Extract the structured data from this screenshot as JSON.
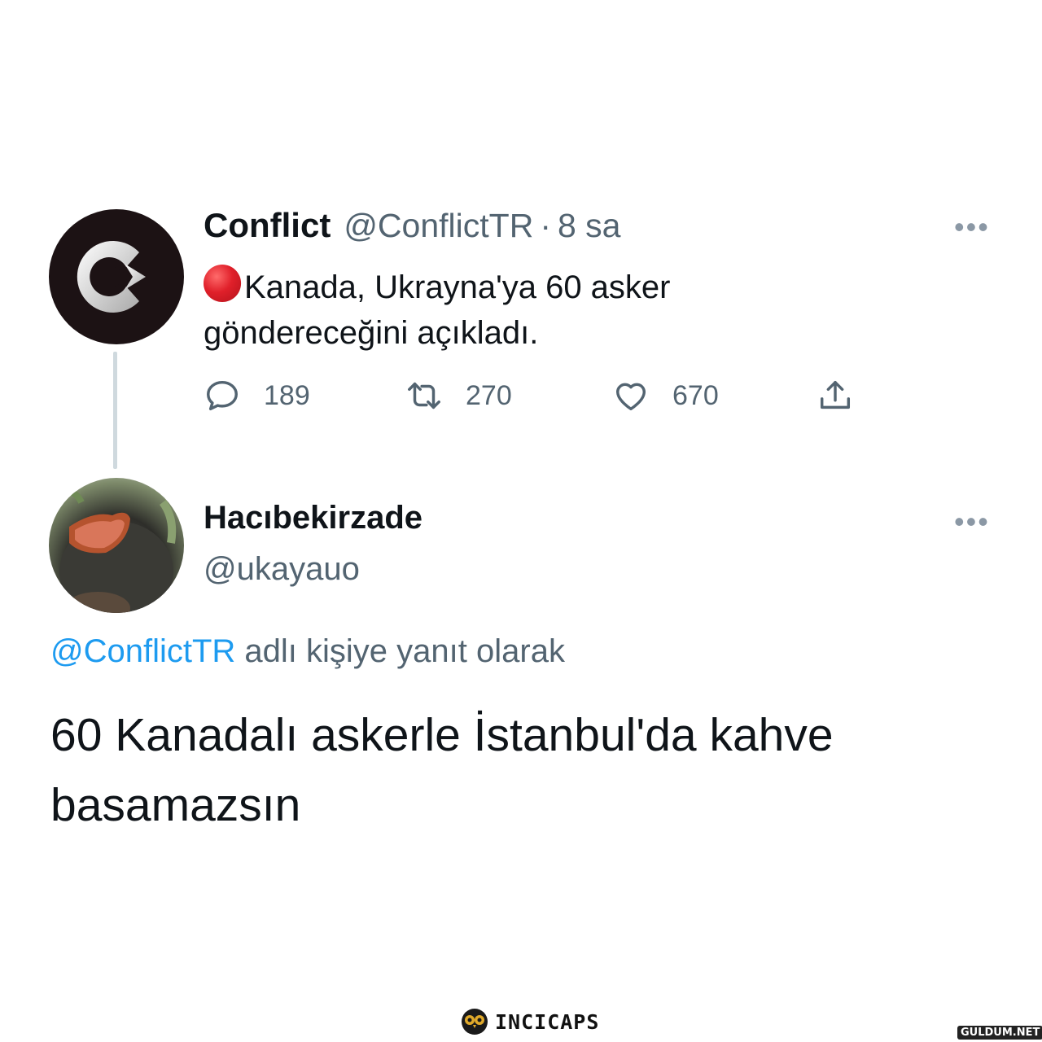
{
  "tweet": {
    "name": "Conflict",
    "handle": "@ConflictTR",
    "separator": "·",
    "time": "8 sa",
    "text_line1": "Kanada, Ukrayna'ya 60 asker",
    "text_line2": "göndereceğini açıkladı.",
    "more": "•••",
    "reply_count": "189",
    "retweet_count": "270",
    "like_count": "670"
  },
  "reply": {
    "name": "Hacıbekirzade",
    "handle": "@ukayauo",
    "more": "•••",
    "reply_mention": "@ConflictTR",
    "reply_suffix": " adlı kişiye yanıt olarak",
    "text_line1": "60 Kanadalı askerle İstanbul'da kahve",
    "text_line2": "basamazsın"
  },
  "footer": {
    "logo_text": "INCICAPS",
    "watermark": "GULDUM.NET"
  },
  "colors": {
    "link_blue": "#1d9bf0",
    "muted_gray": "#536471",
    "text": "#0f1419",
    "alert_red": "#e0202a"
  },
  "icons": [
    "conflict-logo-icon",
    "red-circle-icon",
    "reply-icon",
    "retweet-icon",
    "like-icon",
    "share-icon",
    "more-icon",
    "owl-logo-icon"
  ]
}
